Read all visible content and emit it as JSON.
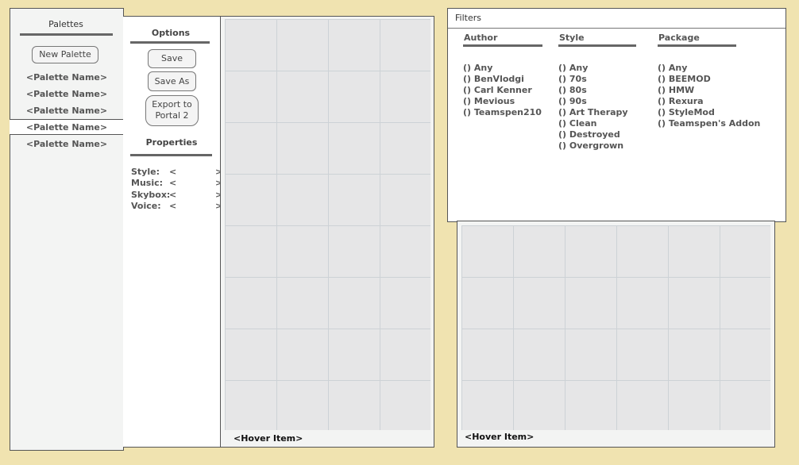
{
  "palettes": {
    "title": "Palettes",
    "new_button": "New Palette",
    "items": [
      "<Palette Name>",
      "<Palette Name>",
      "<Palette Name>",
      "<Palette Name>",
      "<Palette Name>"
    ],
    "selected_index": 3
  },
  "options": {
    "title": "Options",
    "save_label": "Save",
    "save_as_label": "Save As",
    "export_line1": "Export to",
    "export_line2": "Portal 2",
    "properties_title": "Properties",
    "props": [
      {
        "label": "Style:",
        "prev": "<",
        "next": ">"
      },
      {
        "label": "Music:",
        "prev": "<",
        "next": ">"
      },
      {
        "label": "Skybox:",
        "prev": "<",
        "next": ">"
      },
      {
        "label": "Voice:",
        "prev": "<",
        "next": ">"
      }
    ]
  },
  "left_grid": {
    "hover_label": "<Hover Item>"
  },
  "right_grid": {
    "hover_label": "<Hover Item>"
  },
  "filters": {
    "title": "Filters",
    "author": {
      "header": "Author",
      "options": [
        "() Any",
        "() BenVlodgi",
        "() Carl Kenner",
        "() Mevious",
        "() Teamspen210"
      ]
    },
    "style": {
      "header": "Style",
      "options": [
        "() Any",
        "() 70s",
        "() 80s",
        "() 90s",
        "() Art Therapy",
        "() Clean",
        "() Destroyed",
        "() Overgrown"
      ]
    },
    "package": {
      "header": "Package",
      "options": [
        "() Any",
        "() BEEMOD",
        "() HMW",
        "() Rexura",
        "() StyleMod",
        "() Teamspen's Addon"
      ]
    }
  }
}
